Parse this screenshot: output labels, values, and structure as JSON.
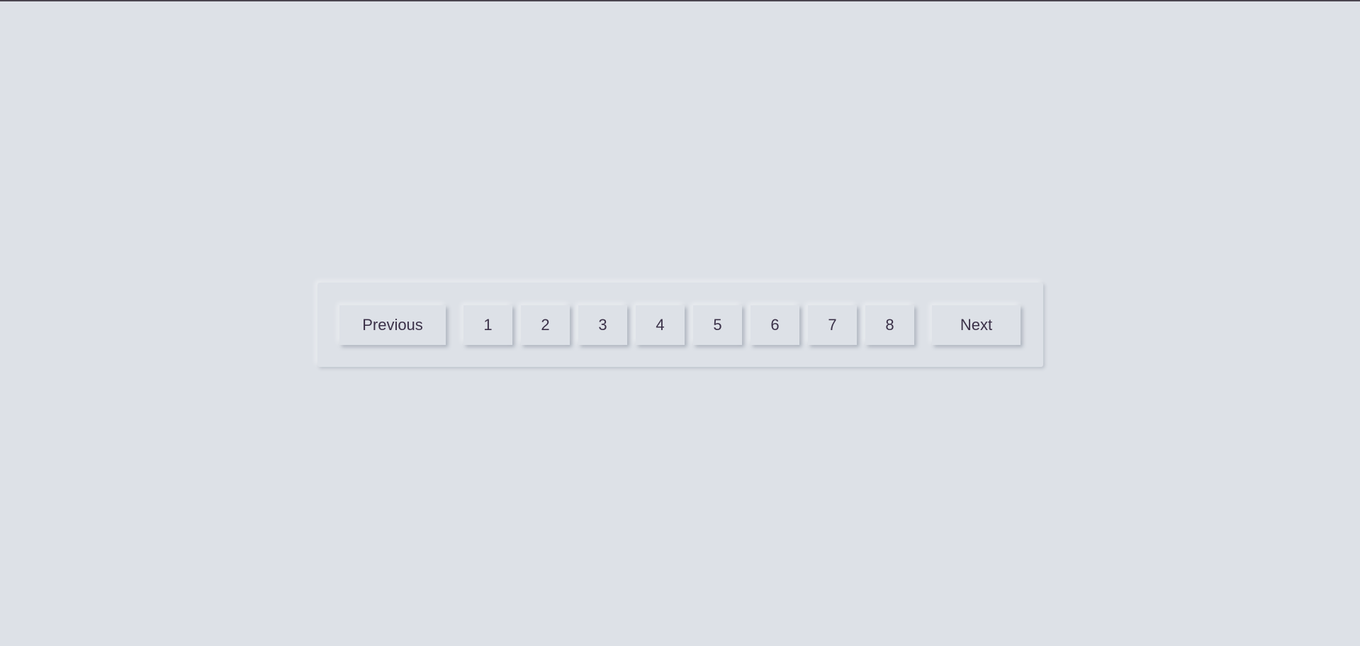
{
  "pagination": {
    "previous_label": "Previous",
    "next_label": "Next",
    "pages": [
      "1",
      "2",
      "3",
      "4",
      "5",
      "6",
      "7",
      "8"
    ]
  }
}
